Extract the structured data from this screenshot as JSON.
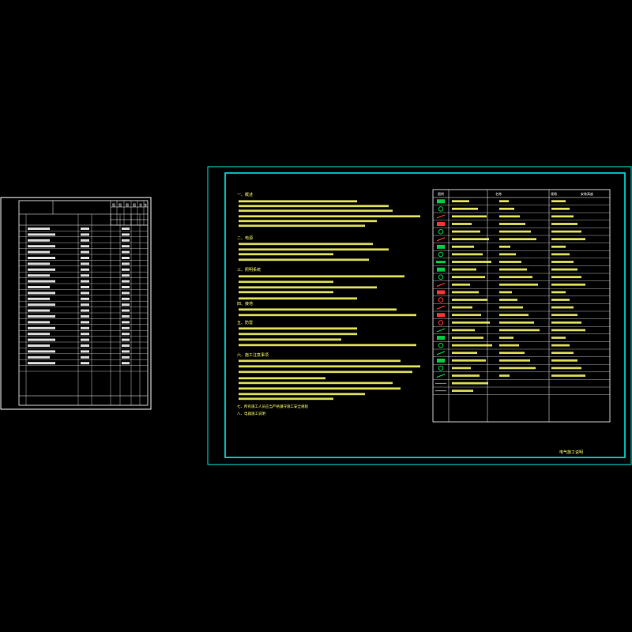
{
  "drawing_title": "电气施工说明",
  "left_sheet": {
    "header_cells": [
      "图",
      "图",
      "图",
      "图",
      "张",
      "张"
    ],
    "rows": 25
  },
  "notes": {
    "section_titles": [
      "一、概述",
      "二、电源",
      "三、照明系统",
      "四、接地",
      "五、防雷",
      "六、施工注意事项"
    ],
    "tail_lines": [
      "七、所有施工人员应当严格遵守施工安全规程",
      "八、电器施工说明"
    ]
  },
  "legend": {
    "headers": [
      "图例",
      "名称",
      "规格",
      "安装高度"
    ],
    "rows": 26
  },
  "colors": {
    "frame": "#00e5e5",
    "line": "#ffffff",
    "accent": "#00cc44",
    "accent2": "#ff3333",
    "text_yellow": "#ffff66"
  }
}
